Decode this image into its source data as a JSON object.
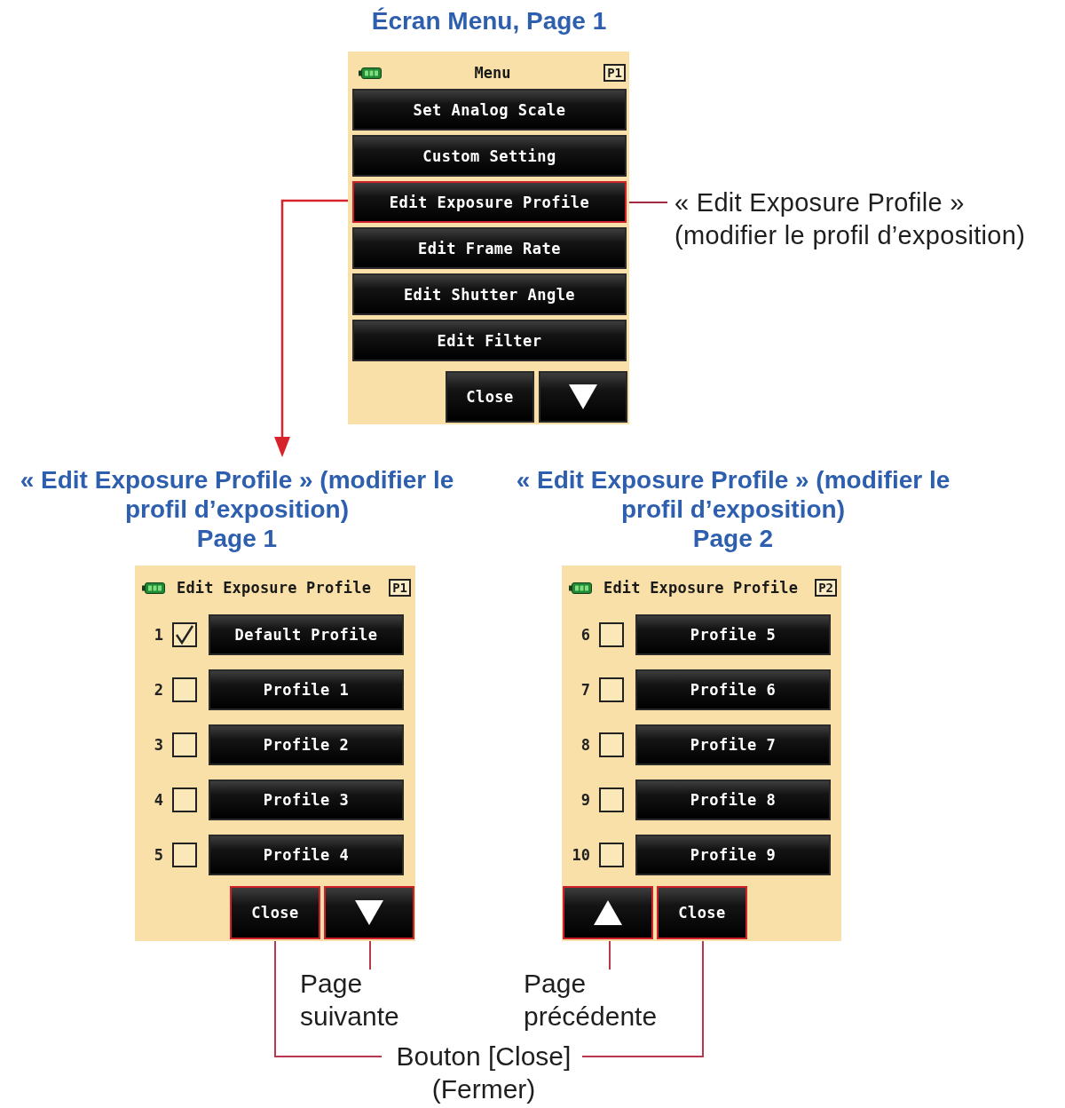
{
  "menu_screen": {
    "heading": "Écran Menu, Page 1",
    "title": "Menu",
    "page_badge": "P1",
    "items": [
      {
        "label": "Set Analog Scale",
        "highlighted": false
      },
      {
        "label": "Custom Setting",
        "highlighted": false
      },
      {
        "label": "Edit Exposure Profile",
        "highlighted": true
      },
      {
        "label": "Edit Frame Rate",
        "highlighted": false
      },
      {
        "label": "Edit Shutter Angle",
        "highlighted": false
      },
      {
        "label": "Edit Filter",
        "highlighted": false
      }
    ],
    "buttons": [
      {
        "kind": "text",
        "label": "Close",
        "highlighted": false
      },
      {
        "kind": "next",
        "highlighted": false
      }
    ]
  },
  "callout": {
    "lines": [
      "« Edit Exposure Profile »",
      "(modifier le profil d’exposition)"
    ]
  },
  "profile_screens": [
    {
      "heading_lines": [
        "« Edit Exposure Profile » (modifier le",
        "profil d’exposition)",
        "Page 1"
      ],
      "title": "Edit Exposure Profile",
      "page_badge": "P1",
      "rows": [
        {
          "number": "1",
          "checked": true,
          "label": "Default Profile"
        },
        {
          "number": "2",
          "checked": false,
          "label": "Profile 1"
        },
        {
          "number": "3",
          "checked": false,
          "label": "Profile 2"
        },
        {
          "number": "4",
          "checked": false,
          "label": "Profile 3"
        },
        {
          "number": "5",
          "checked": false,
          "label": "Profile 4"
        }
      ],
      "buttons": [
        {
          "kind": "text",
          "label": "Close",
          "highlighted": true
        },
        {
          "kind": "next",
          "highlighted": true
        }
      ]
    },
    {
      "heading_lines": [
        "« Edit Exposure Profile » (modifier le",
        "profil d’exposition)",
        "Page 2"
      ],
      "title": "Edit Exposure Profile",
      "page_badge": "P2",
      "rows": [
        {
          "number": "6",
          "checked": false,
          "label": "Profile 5"
        },
        {
          "number": "7",
          "checked": false,
          "label": "Profile 6"
        },
        {
          "number": "8",
          "checked": false,
          "label": "Profile 7"
        },
        {
          "number": "9",
          "checked": false,
          "label": "Profile 8"
        },
        {
          "number": "10",
          "checked": false,
          "label": "Profile 9"
        }
      ],
      "buttons": [
        {
          "kind": "previous",
          "highlighted": true
        },
        {
          "kind": "text",
          "label": "Close",
          "highlighted": true
        }
      ]
    }
  ],
  "annotations": [
    {
      "lines": [
        "Page",
        "suivante"
      ]
    },
    {
      "lines": [
        "Page",
        "précédente"
      ]
    },
    {
      "lines": [
        "Bouton [Close]",
        "(Fermer)"
      ]
    }
  ]
}
